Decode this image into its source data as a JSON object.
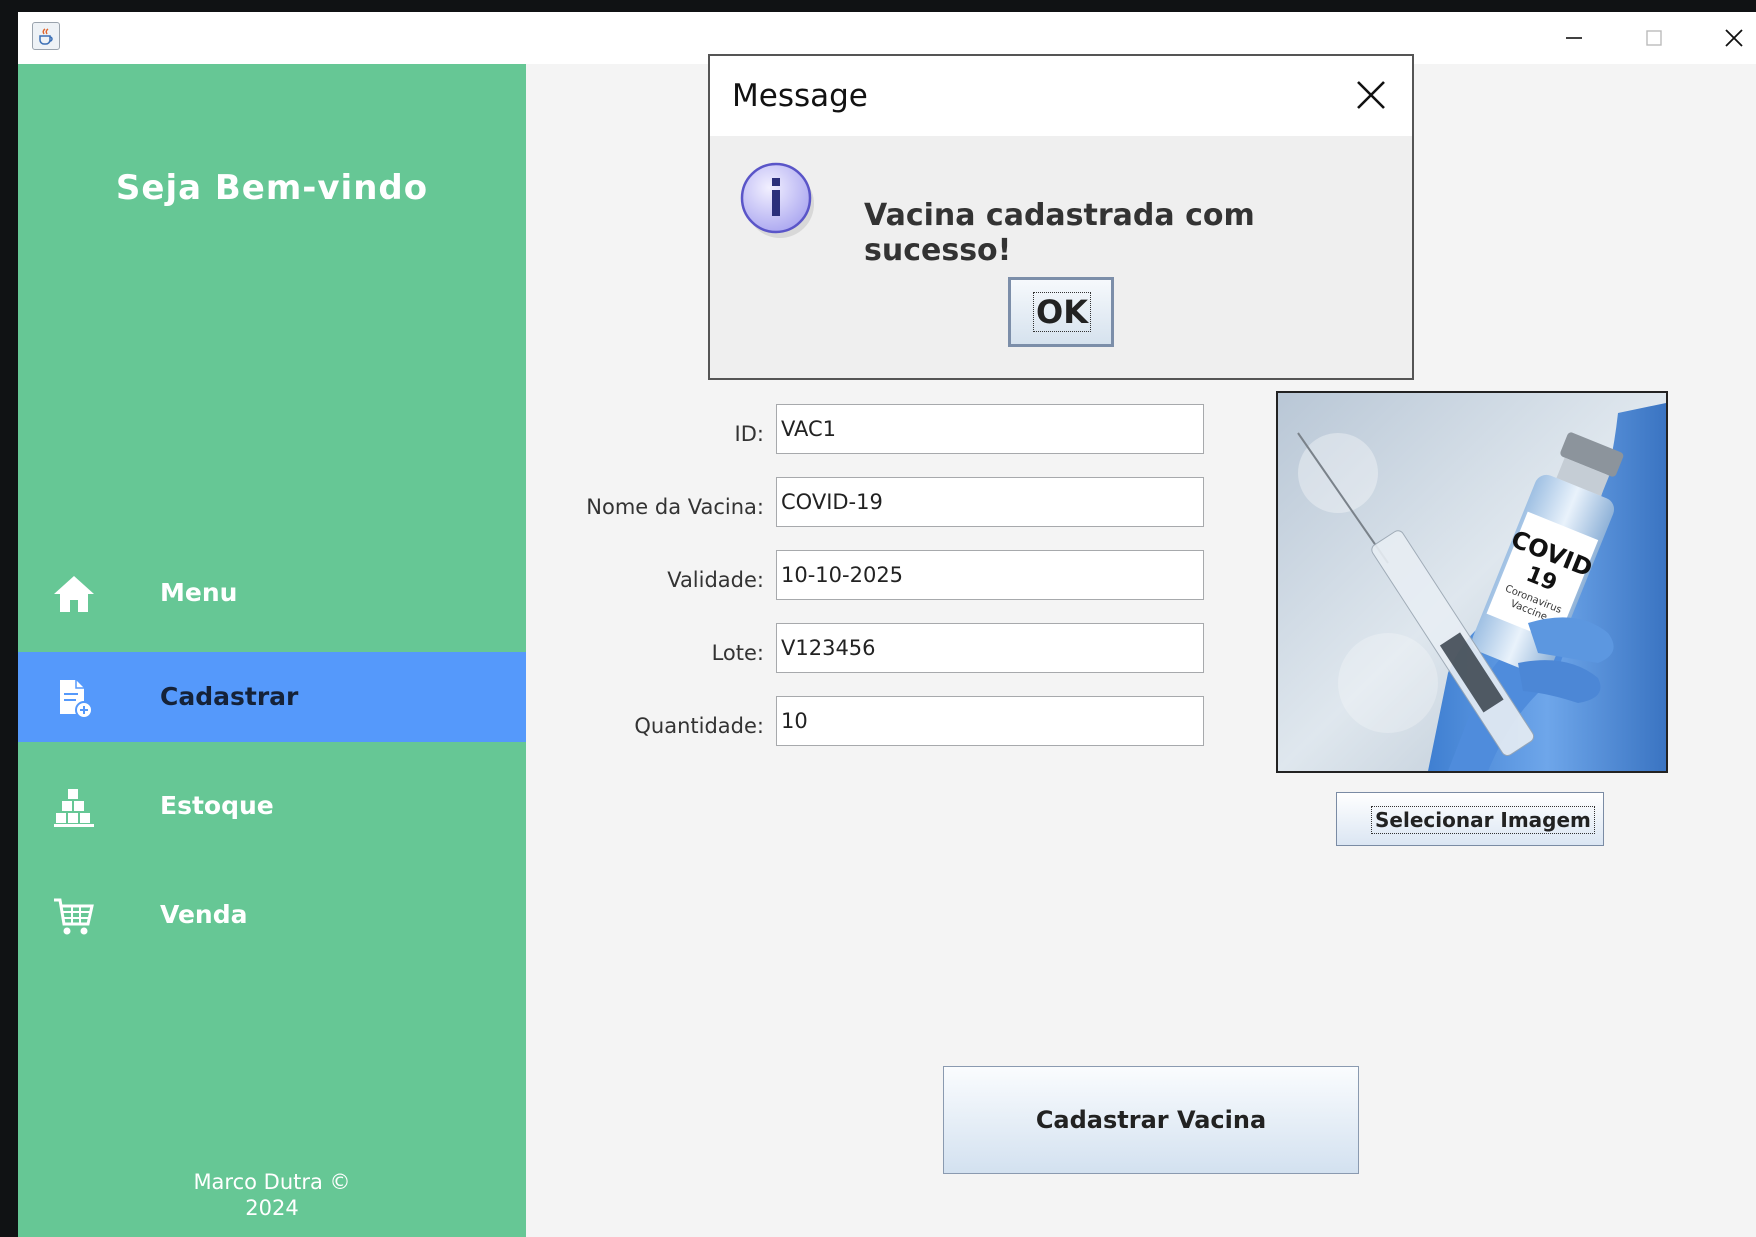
{
  "window": {
    "app_icon": "java-cup-icon",
    "controls": [
      "minimize-icon",
      "maximize-icon",
      "close-icon"
    ]
  },
  "sidebar": {
    "welcome": "Seja Bem-vindo",
    "items": [
      {
        "label": "Menu",
        "icon": "home-icon",
        "active": false
      },
      {
        "label": "Cadastrar",
        "icon": "document-add-icon",
        "active": true
      },
      {
        "label": "Estoque",
        "icon": "warehouse-boxes-icon",
        "active": false
      },
      {
        "label": "Venda",
        "icon": "shopping-cart-icon",
        "active": false
      }
    ],
    "footer_line1": "Marco Dutra ©",
    "footer_line2": "2024"
  },
  "form": {
    "fields": [
      {
        "label": "ID:",
        "value": "VAC1"
      },
      {
        "label": "Nome da Vacina:",
        "value": "COVID-19"
      },
      {
        "label": "Validade:",
        "value": "10-10-2025"
      },
      {
        "label": "Lote:",
        "value": "V123456"
      },
      {
        "label": "Quantidade:",
        "value": "10"
      }
    ],
    "image_label_line1": "COVID",
    "image_label_line2": "19",
    "image_label_small1": "Coronavirus",
    "image_label_small2": "Vaccine",
    "select_image_button": "Selecionar Imagem",
    "submit_button": "Cadastrar Vacina"
  },
  "dialog": {
    "title": "Message",
    "message": "Vacina cadastrada com sucesso!",
    "ok_label": "OK",
    "icon": "info-icon"
  },
  "colors": {
    "sidebar": "#66c795",
    "active_item": "#5599fb",
    "content_bg": "#f4f4f4"
  }
}
